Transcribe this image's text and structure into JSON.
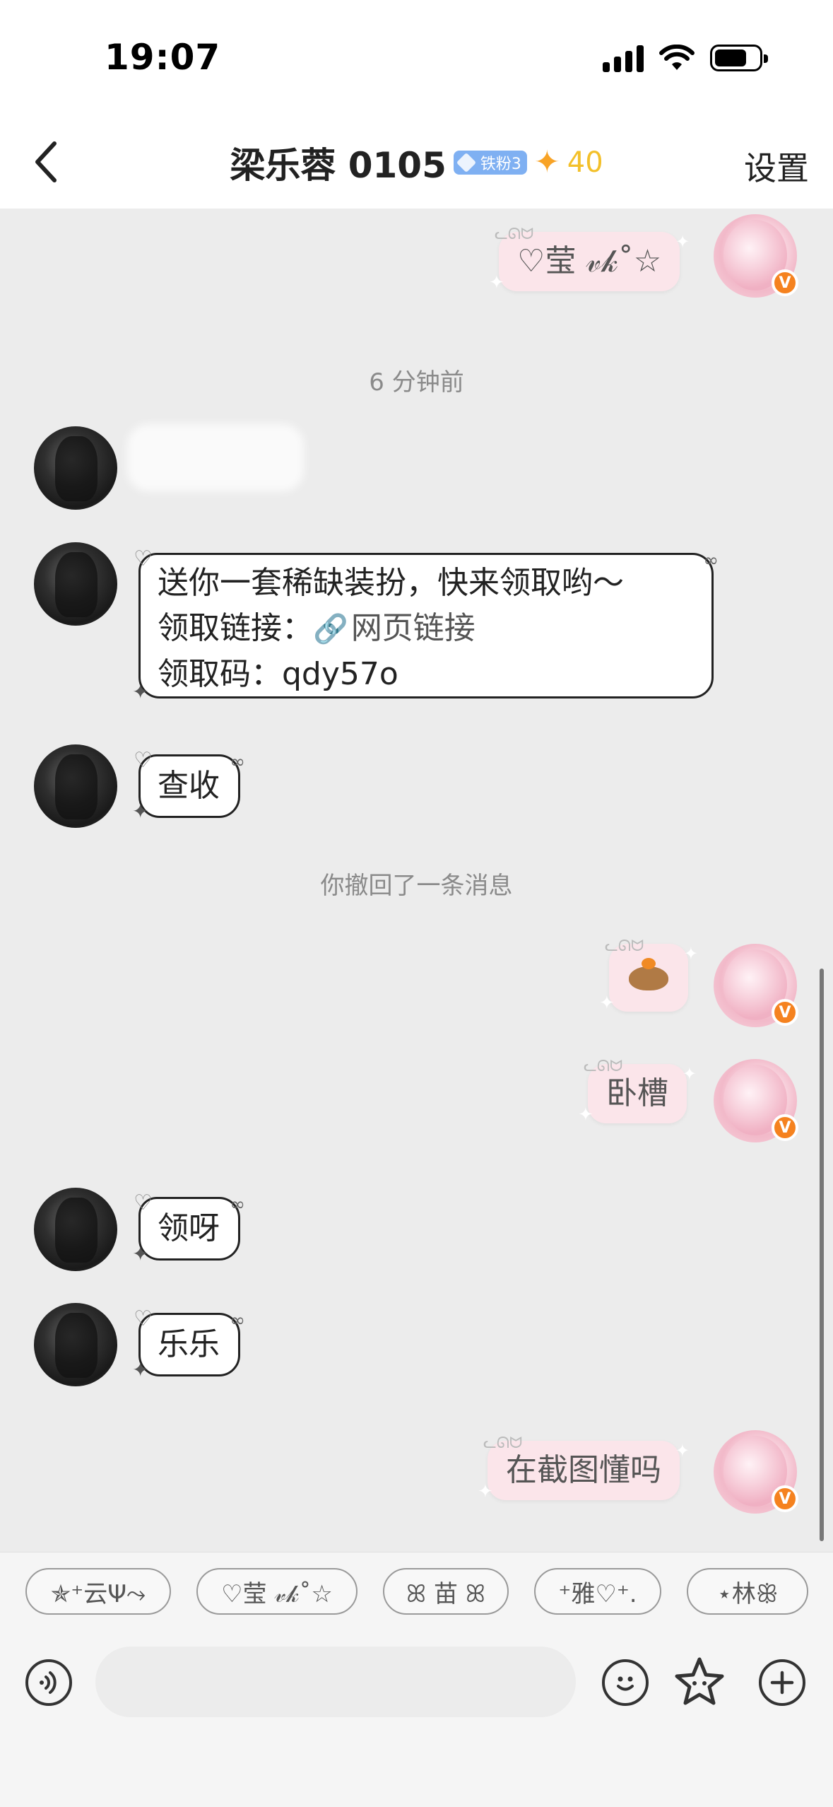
{
  "status_bar": {
    "time": "19:07"
  },
  "header": {
    "title": "梁乐蓉 0105",
    "fan_badge": "铁粉3",
    "spark_count": "40",
    "settings_label": "设置"
  },
  "messages": {
    "m1_right_text": "♡莹 𝓋𝓀˚☆",
    "time_divider": "6 分钟前",
    "m3_line1": "送你一套稀缺装扮，快来领取哟～",
    "m3_line2_prefix": "领取链接：",
    "m3_line2_link": "网页链接",
    "m3_line3": "领取码：qdy57o",
    "m4_text": "查收",
    "recall_notice": "你撤回了一条消息",
    "m6_right_text": "卧槽",
    "m7_text": "领呀",
    "m8_text": "乐乐",
    "m9_right_text": "在截图懂吗"
  },
  "quick_replies": [
    {
      "label": "✯⁺云Ψ⤳"
    },
    {
      "label": "♡莹 𝓋𝓀˚☆"
    },
    {
      "label": "ꕤ 苗 ꕤ"
    },
    {
      "label": "⁺雅♡⁺."
    },
    {
      "label": "⋆林ꕥ"
    }
  ],
  "input": {
    "placeholder": ""
  },
  "icons": {
    "back": "chevron-left-icon",
    "voice": "voice-icon",
    "emoji": "emoji-icon",
    "sticker": "star-sticker-icon",
    "plus": "plus-icon",
    "verified": "v-badge-icon"
  },
  "colors": {
    "chat_background": "#ececec",
    "right_bubble": "#fbe5ea",
    "vip_badge": "#f5821f",
    "fan_badge": "#7fb0f2",
    "spark": "#f3c02a"
  }
}
